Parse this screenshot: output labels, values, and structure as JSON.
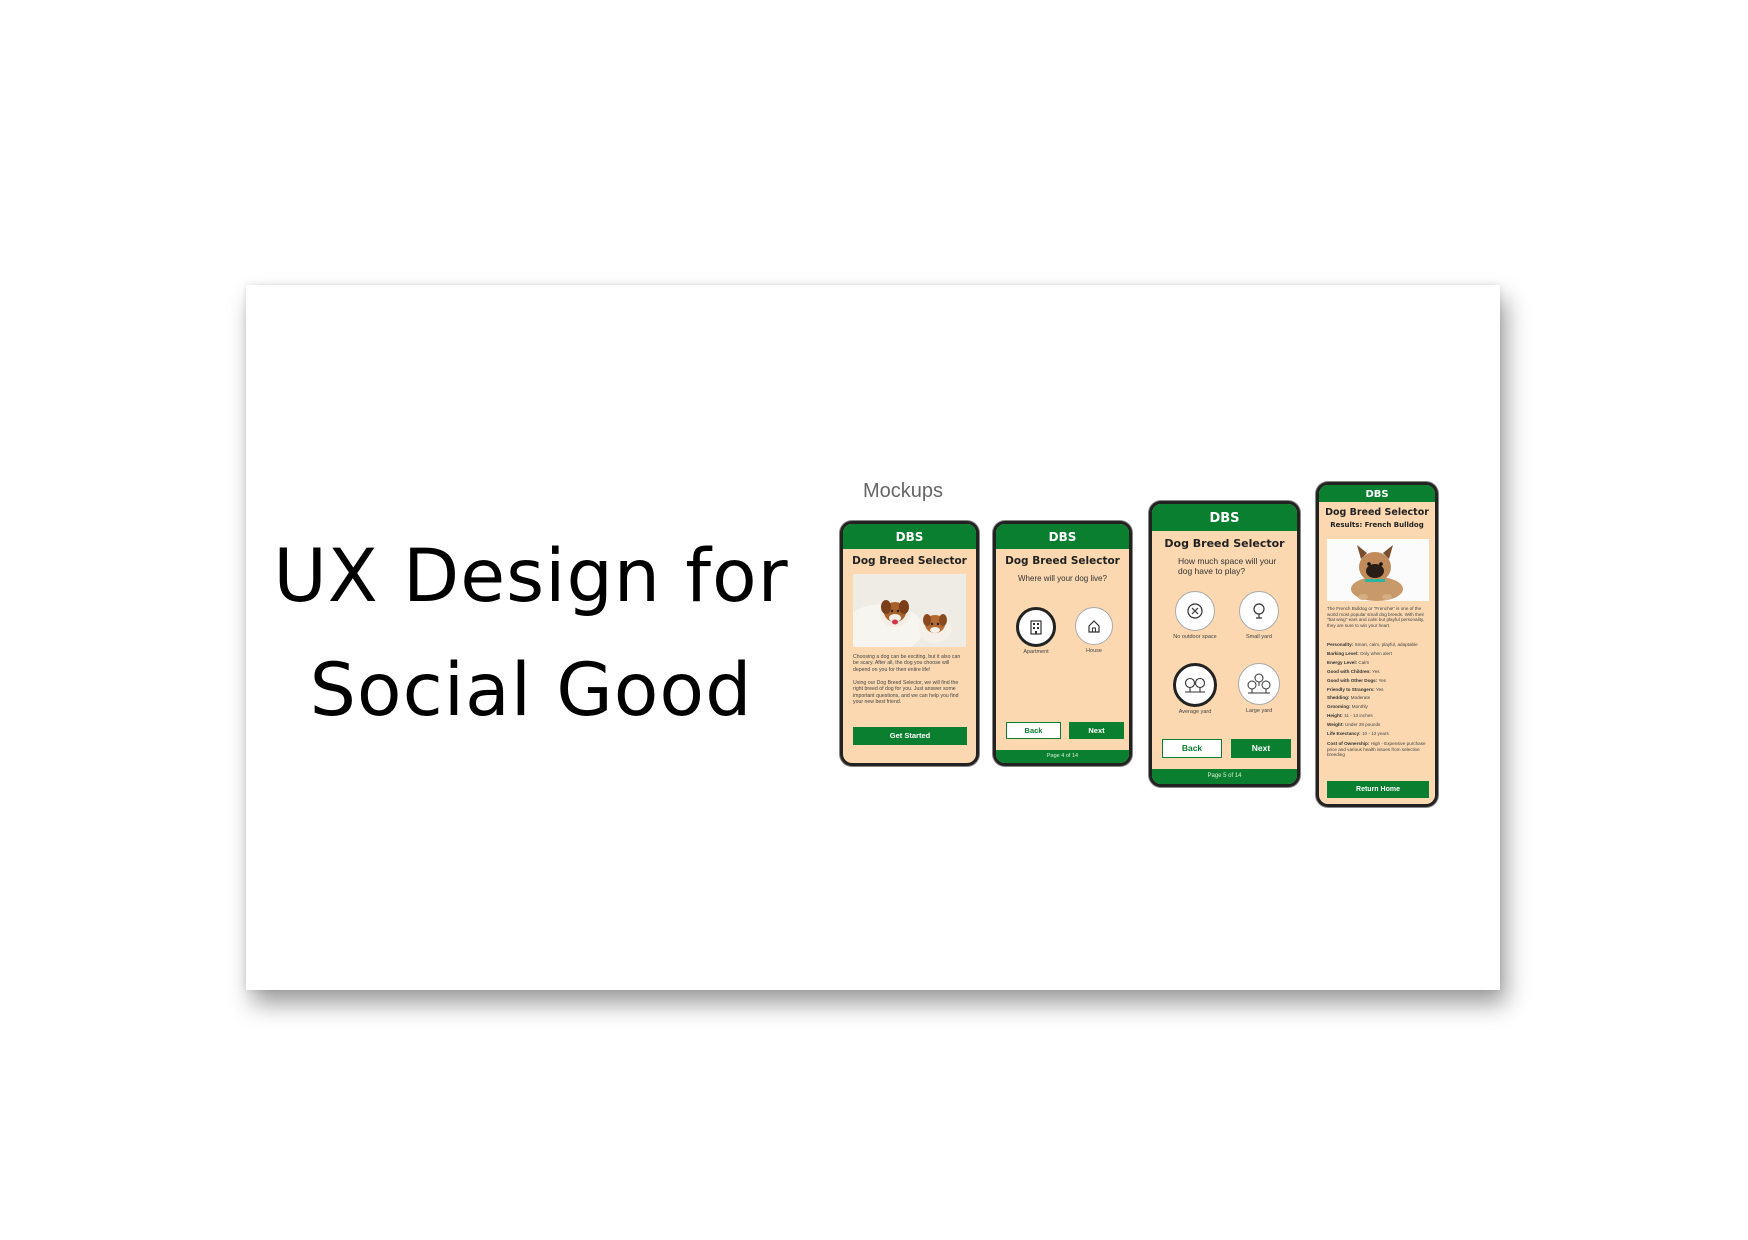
{
  "slide": {
    "title_line1": "UX Design for",
    "title_line2": "Social Good",
    "mockups_label": "Mockups"
  },
  "colors": {
    "accent_green": "#0a7f2f",
    "phone_bg": "#fbd8b0"
  },
  "phone1": {
    "header": "DBS",
    "title": "Dog Breed Selector",
    "para1": "Choosing a dog can be exciting, but it also can be scary. After all, the dog you choose will depend on you for their entire life!",
    "para2": "Using our Dog Breed Selector, we will find the right breed of dog for you. Just answer some important questions, and we can help you find your new best friend.",
    "button": "Get Started"
  },
  "phone2": {
    "header": "DBS",
    "title": "Dog Breed Selector",
    "question": "Where will your dog live?",
    "options": [
      {
        "label": "Apartment",
        "icon": "building-icon"
      },
      {
        "label": "House",
        "icon": "house-icon"
      }
    ],
    "back": "Back",
    "next": "Next",
    "page": "Page 4 of 14"
  },
  "phone3": {
    "header": "DBS",
    "title": "Dog Breed Selector",
    "question": "How much space will your dog have to play?",
    "options": [
      {
        "label": "No outdoor space",
        "icon": "x-circle-icon"
      },
      {
        "label": "Small yard",
        "icon": "tree-icon"
      },
      {
        "label": "Average yard",
        "icon": "two-trees-icon"
      },
      {
        "label": "Large yard",
        "icon": "three-trees-icon"
      }
    ],
    "back": "Back",
    "next": "Next",
    "page": "Page 5 of 14"
  },
  "phone4": {
    "header": "DBS",
    "title": "Dog Breed Selector",
    "subtitle": "Results: French Bulldog",
    "desc": "The French Bulldog or \"Frenchie\" is one of the world most popular small dog breeds. With their \"bat wing\" ears and calm but playful personality, they are sure to win your heart.",
    "attributes": [
      {
        "k": "Personality:",
        "v": "Smart, calm, playful, adaptable"
      },
      {
        "k": "Barking Level:",
        "v": "Only when alert"
      },
      {
        "k": "Energy Level:",
        "v": "Calm"
      },
      {
        "k": "Good with Children:",
        "v": "Yes"
      },
      {
        "k": "Good with Other Dogs:",
        "v": "Yes"
      },
      {
        "k": "Friendly to Strangers:",
        "v": "Yes"
      },
      {
        "k": "Shedding:",
        "v": "Moderate"
      },
      {
        "k": "Grooming:",
        "v": "Monthly"
      },
      {
        "k": "Height:",
        "v": "11 - 13 inches"
      },
      {
        "k": "Weight:",
        "v": "Under 28 pounds"
      },
      {
        "k": "Life Exectancy:",
        "v": "10 - 12 years"
      },
      {
        "k": "Cost of Ownership:",
        "v": "High - Expensive purchase price and various health issues from selective breeding"
      }
    ],
    "button": "Return Home"
  }
}
